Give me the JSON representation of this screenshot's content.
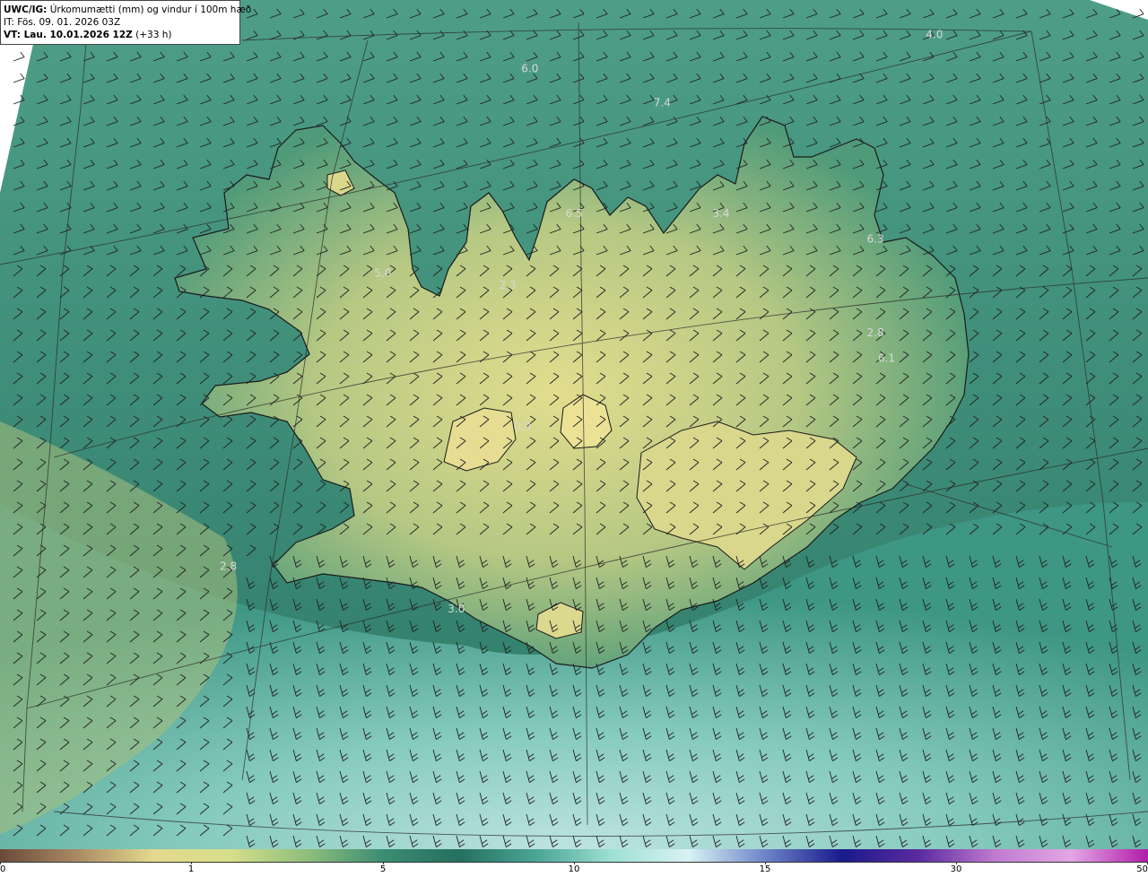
{
  "header": {
    "model": "UWC/IG:",
    "description": "Úrkomumætti (mm) og vindur í 100m hæð",
    "it_line": "IT: Fös. 09. 01. 2026 03Z",
    "vt_label": "VT: Lau. 10.01.2026 12Z",
    "vt_offset": "(+33 h)"
  },
  "map_labels": [
    {
      "text": "6.0",
      "lon": -19.6,
      "lat": 67.05
    },
    {
      "text": "7.4",
      "lon": -17.8,
      "lat": 66.85
    },
    {
      "text": "4.0",
      "lon": -14.1,
      "lat": 67.25
    },
    {
      "text": "6.5",
      "lon": -19.0,
      "lat": 66.2
    },
    {
      "text": "3.4",
      "lon": -17.0,
      "lat": 66.2
    },
    {
      "text": "6.3",
      "lon": -14.9,
      "lat": 66.05
    },
    {
      "text": "5.0",
      "lon": -21.6,
      "lat": 65.85
    },
    {
      "text": "2.3",
      "lon": -19.9,
      "lat": 65.78
    },
    {
      "text": "2.8",
      "lon": -14.9,
      "lat": 65.5
    },
    {
      "text": "6.1",
      "lon": -14.75,
      "lat": 65.35
    },
    {
      "text": "0.9",
      "lon": -19.7,
      "lat": 64.95
    },
    {
      "text": "2.8",
      "lon": -23.7,
      "lat": 64.13
    },
    {
      "text": "3.0",
      "lon": -20.6,
      "lat": 63.88
    }
  ],
  "colorbar": {
    "ticks": [
      {
        "label": "0",
        "value": 0
      },
      {
        "label": "1",
        "value": 1
      },
      {
        "label": "5",
        "value": 5
      },
      {
        "label": "10",
        "value": 10
      },
      {
        "label": "15",
        "value": 15
      },
      {
        "label": "30",
        "value": 30
      },
      {
        "label": "50",
        "value": 50
      }
    ],
    "colors": [
      "#6b4a3a",
      "#a98a62",
      "#e3d98e",
      "#d7df8a",
      "#8fbf7c",
      "#3c8c72",
      "#25705f",
      "#4aa595",
      "#9ee0d4",
      "#d8f2f4",
      "#6d84c8",
      "#1a1a8c",
      "#5b2aa0",
      "#c07ad0",
      "#e3a6e4",
      "#b11ca8"
    ]
  }
}
